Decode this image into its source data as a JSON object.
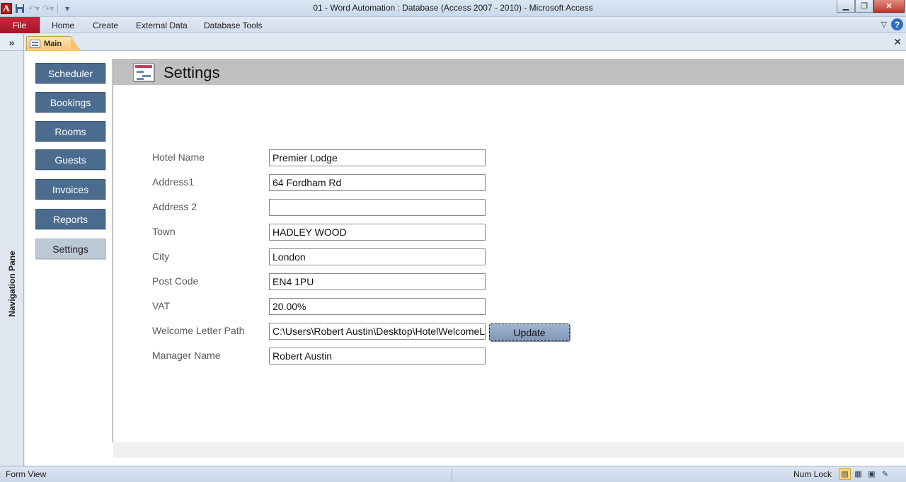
{
  "window": {
    "title": "01 - Word Automation : Database (Access 2007 - 2010)  -  Microsoft Access",
    "app_icon_letter": "A"
  },
  "ribbon": {
    "file_label": "File",
    "tabs": [
      "Home",
      "Create",
      "External Data",
      "Database Tools"
    ]
  },
  "nav_pane": {
    "toggle": "»",
    "label": "Navigation Pane"
  },
  "document": {
    "tab_label": "Main"
  },
  "menu": [
    {
      "label": "Scheduler",
      "active": false
    },
    {
      "label": "Bookings",
      "active": false
    },
    {
      "label": "Rooms",
      "active": false
    },
    {
      "label": "Guests",
      "active": false
    },
    {
      "label": "Invoices",
      "active": false
    },
    {
      "label": "Reports",
      "active": false
    },
    {
      "label": "Settings",
      "active": true
    }
  ],
  "form": {
    "title": "Settings",
    "fields": [
      {
        "label": "Hotel Name",
        "value": "Premier Lodge"
      },
      {
        "label": "Address1",
        "value": "64 Fordham Rd"
      },
      {
        "label": "Address 2",
        "value": ""
      },
      {
        "label": "Town",
        "value": "HADLEY WOOD"
      },
      {
        "label": "City",
        "value": "London"
      },
      {
        "label": "Post Code",
        "value": "EN4 1PU"
      },
      {
        "label": "VAT",
        "value": "20.00%"
      },
      {
        "label": "Welcome Letter Path",
        "value": "C:\\Users\\Robert Austin\\Desktop\\HotelWelcomeLetter.d"
      },
      {
        "label": "Manager Name",
        "value": "Robert Austin"
      }
    ],
    "update_button": "Update"
  },
  "statusbar": {
    "left": "Form View",
    "numlock": "Num Lock"
  },
  "colors": {
    "menu_button": "#4b6b8f",
    "menu_button_active": "#bdc8d5",
    "file_tab": "#b01c31",
    "header_band": "#c0c0c0"
  }
}
